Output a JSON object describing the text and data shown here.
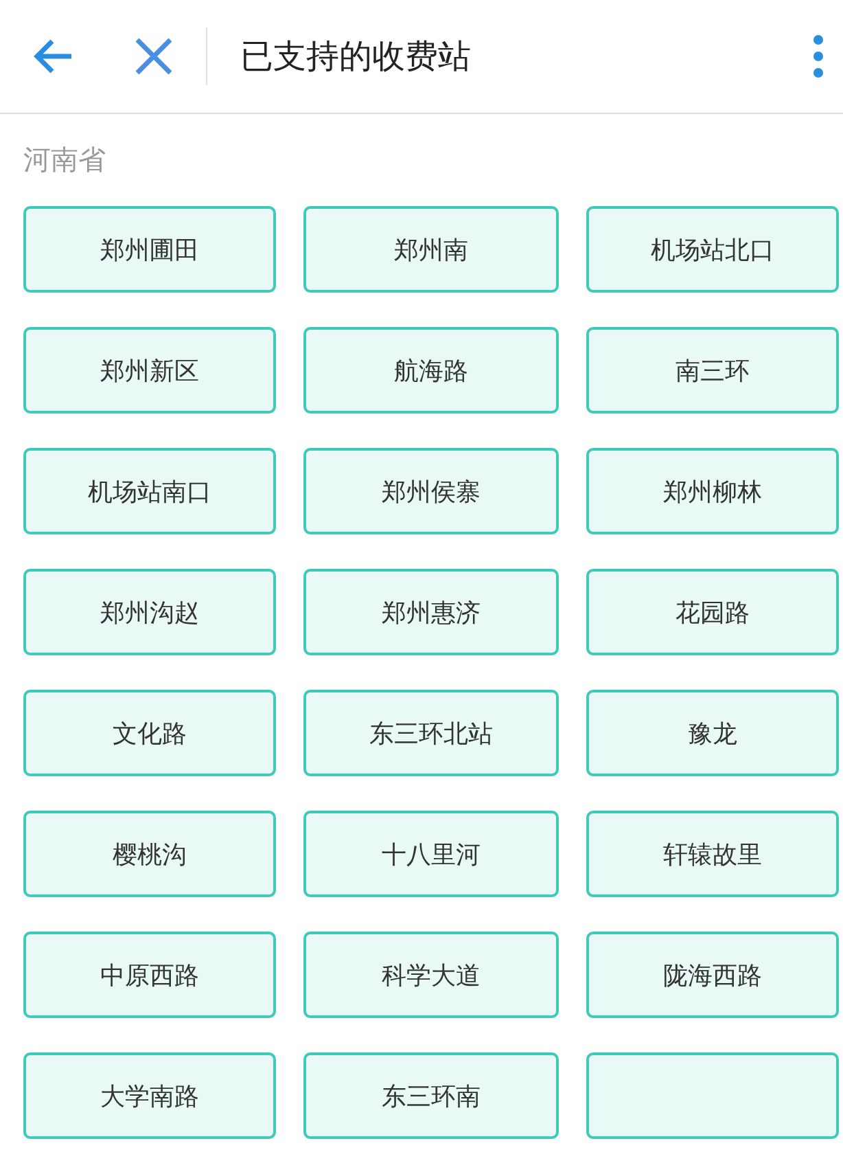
{
  "header": {
    "title": "已支持的收费站"
  },
  "section": {
    "title": "河南省"
  },
  "stations": [
    {
      "label": "郑州圃田"
    },
    {
      "label": "郑州南"
    },
    {
      "label": "机场站北口"
    },
    {
      "label": "郑州新区"
    },
    {
      "label": "航海路"
    },
    {
      "label": "南三环"
    },
    {
      "label": "机场站南口"
    },
    {
      "label": "郑州侯寨"
    },
    {
      "label": "郑州柳林"
    },
    {
      "label": "郑州沟赵"
    },
    {
      "label": "郑州惠济"
    },
    {
      "label": "花园路"
    },
    {
      "label": "文化路"
    },
    {
      "label": "东三环北站"
    },
    {
      "label": "豫龙"
    },
    {
      "label": "樱桃沟"
    },
    {
      "label": "十八里河"
    },
    {
      "label": "轩辕故里"
    },
    {
      "label": "中原西路"
    },
    {
      "label": "科学大道"
    },
    {
      "label": "陇海西路"
    },
    {
      "label": "大学南路"
    },
    {
      "label": "东三环南"
    },
    {
      "kind": "covered"
    }
  ]
}
